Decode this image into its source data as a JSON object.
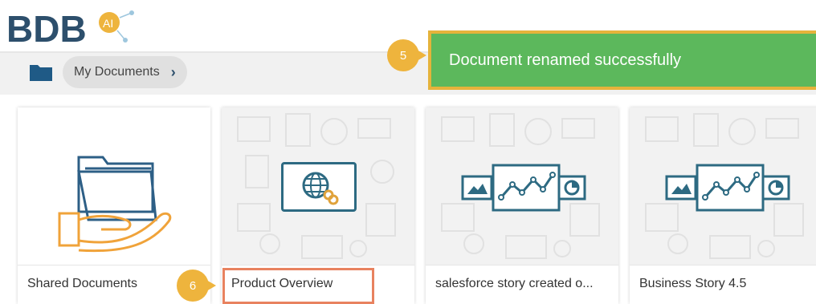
{
  "header": {
    "logo_text": "BDB",
    "logo_badge": "AI"
  },
  "breadcrumb": {
    "icon": "folder-icon",
    "item_label": "My Documents",
    "chevron": "›"
  },
  "toast": {
    "message": "Document renamed successfully",
    "color": "#5cb85c"
  },
  "steps": {
    "toast_step": "5",
    "rename_step": "6"
  },
  "cards": [
    {
      "label": "Shared Documents",
      "thumb": "shared-folder-hand-icon"
    },
    {
      "label": "Product Overview",
      "thumb": "globe-link-icon"
    },
    {
      "label": "salesforce story created o...",
      "thumb": "story-chart-icon"
    },
    {
      "label": "Business Story 4.5",
      "thumb": "story-chart-icon"
    }
  ],
  "colors": {
    "brand": "#2d4f6c",
    "accent": "#eeb43d",
    "highlight": "#e8825f"
  }
}
